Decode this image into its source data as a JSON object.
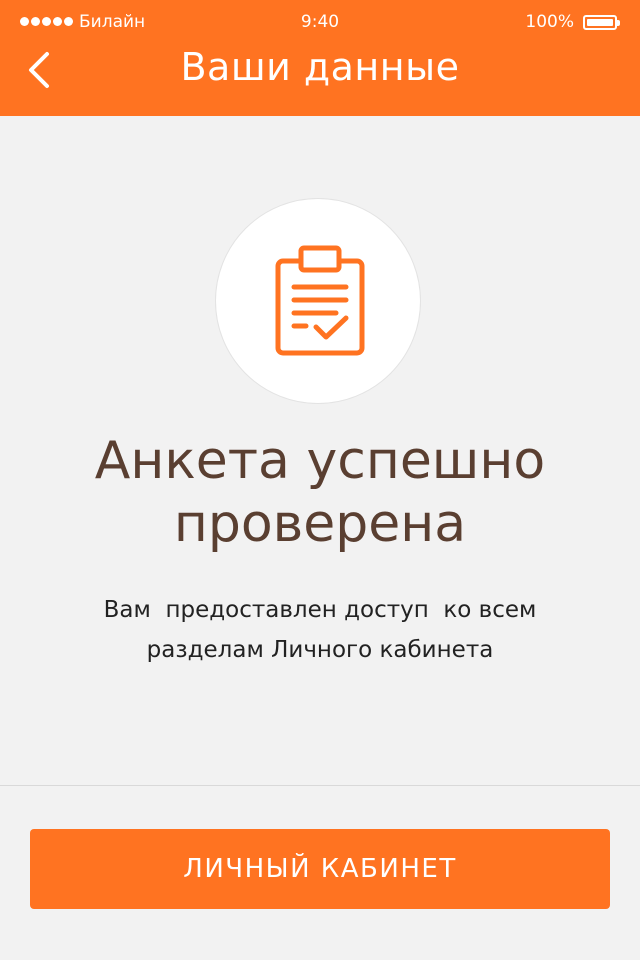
{
  "status_bar": {
    "carrier": "Билайн",
    "time": "9:40",
    "battery": "100%"
  },
  "header": {
    "title": "Ваши данные",
    "back_icon": "chevron-left-icon"
  },
  "result": {
    "icon": "clipboard-check-icon",
    "heading_lines": [
      "Анкета успешно",
      "проверена"
    ],
    "description_lines": [
      "Вам  предоставлен доступ  ко всем",
      "разделам Личного кабинета"
    ]
  },
  "actions": {
    "cabinet_label": "ЛИЧНЫЙ КАБИНЕТ"
  },
  "colors": {
    "accent": "#ff7321",
    "heading": "#5a3f31",
    "background": "#f2f2f2"
  }
}
